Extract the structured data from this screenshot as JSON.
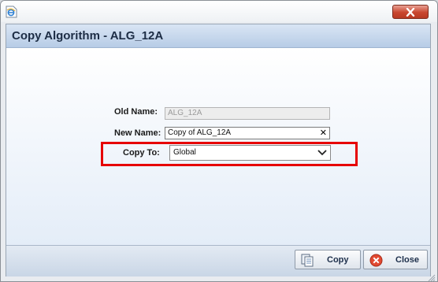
{
  "window": {
    "title": ""
  },
  "dialog": {
    "title": "Copy Algorithm - ALG_12A",
    "old_name": {
      "label": "Old Name:",
      "value": "ALG_12A"
    },
    "new_name": {
      "label": "New Name:",
      "value": "Copy of ALG_12A"
    },
    "copy_to": {
      "label": "Copy To:",
      "selected": "Global"
    }
  },
  "buttons": {
    "copy": "Copy",
    "close": "Close"
  },
  "icons": {
    "app": "ie-page-icon",
    "window_close": "close-icon",
    "clear": "clear-x-icon",
    "dropdown": "chevron-down-icon",
    "copy": "copy-icon",
    "close": "close-circle-icon"
  },
  "colors": {
    "highlight": "#e60000",
    "header": "#b7cce6"
  }
}
